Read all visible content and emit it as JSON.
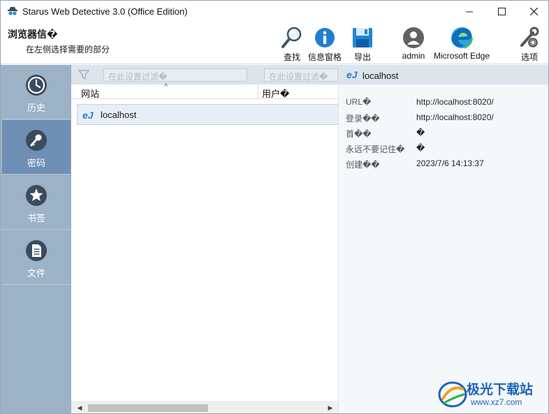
{
  "window": {
    "title": "Starus Web Detective 3.0 (Office Edition)",
    "controls": {
      "minimize": "minimize-icon",
      "maximize": "maximize-icon",
      "close": "close-icon"
    }
  },
  "header": {
    "section_title": "浏览器信�",
    "section_subtitle": "在左侧选择需要的部分",
    "tools": [
      {
        "label": "查找",
        "icon": "search-icon"
      },
      {
        "label": "信息窗格",
        "icon": "info-icon"
      },
      {
        "label": "导出",
        "icon": "save-icon"
      },
      {
        "label": "admin",
        "icon": "user-avatar-icon"
      },
      {
        "label": "Microsoft Edge",
        "icon": "edge-browser-icon"
      },
      {
        "label": "选项",
        "icon": "wrench-gear-icon"
      }
    ]
  },
  "sidebar": {
    "items": [
      {
        "label": "历史",
        "icon": "clock-icon",
        "active": false
      },
      {
        "label": "密码",
        "icon": "key-icon",
        "active": true
      },
      {
        "label": "书签",
        "icon": "star-icon",
        "active": false
      },
      {
        "label": "文件",
        "icon": "document-icon",
        "active": false
      }
    ]
  },
  "list": {
    "filter_placeholder_1": "在此设置过滤�",
    "filter_placeholder_2": "在此设置过滤�",
    "columns": [
      "网站",
      "用户�"
    ],
    "rows": [
      {
        "site": "localhost",
        "user": ""
      }
    ]
  },
  "details": {
    "title": "localhost",
    "properties": [
      {
        "key": "URL�",
        "value": "http://localhost:8020/"
      },
      {
        "key": "登录��",
        "value": "http://localhost:8020/"
      },
      {
        "key": "首��",
        "value": "�"
      },
      {
        "key": "永远不要记住�",
        "value": "�"
      },
      {
        "key": "创建��",
        "value": "2023/7/6 14:13:37"
      }
    ]
  },
  "watermark": {
    "name": "极光下载站",
    "url": "www.xz7.com"
  },
  "colors": {
    "nav_bg": "#9cb2c6",
    "nav_active": "#6f8fb5",
    "filter_bar": "#dce4ec",
    "accent": "#1c63b8"
  }
}
